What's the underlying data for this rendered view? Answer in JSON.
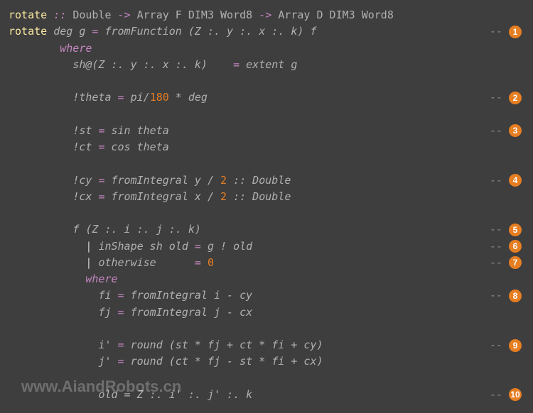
{
  "code": {
    "sig_fn": "rotate",
    "sig_dcolon": "::",
    "sig_t1": "Double",
    "sig_arr": "->",
    "sig_t2": "Array F DIM3 Word8",
    "sig_arr2": "->",
    "sig_t3": "Array D DIM3 Word8",
    "def_fn": "rotate",
    "def_args": "deg g",
    "def_eq": "=",
    "def_body": "fromFunction (Z :. y :. x :. k) f",
    "where": "where",
    "sh_lhs": "sh@(Z :. y :. x :. k)",
    "sh_eq": "=",
    "sh_rhs": "extent g",
    "theta_lhs": "!theta",
    "theta_eq": "=",
    "theta_rhs1": "pi/",
    "theta_180": "180",
    "theta_rhs2": " * deg",
    "st_lhs": "!st",
    "st_eq": "=",
    "st_rhs": "sin theta",
    "ct_lhs": "!ct",
    "ct_eq": "=",
    "ct_rhs": "cos theta",
    "cy_lhs": "!cy",
    "cy_eq": "=",
    "cy_rhs1": "fromIntegral y /",
    "cy_2": "2",
    "cy_rhs2": " :: Double",
    "cx_lhs": "!cx",
    "cx_eq": "=",
    "cx_rhs1": "fromIntegral x /",
    "cx_2": "2",
    "cx_rhs2": " :: Double",
    "f_head": "f (Z :. i :. j :. k)",
    "g1_bar": "|",
    "g1_cond": "inShape sh old",
    "g1_eq": "=",
    "g1_rhs": "g ! old",
    "g2_bar": "|",
    "g2_cond": "otherwise",
    "g2_eq": "=",
    "g2_rhs": "0",
    "where2": "where",
    "fi_lhs": "fi",
    "fi_eq": "=",
    "fi_rhs": "fromIntegral i - cy",
    "fj_lhs": "fj",
    "fj_eq": "=",
    "fj_rhs": "fromIntegral j - cx",
    "ip_lhs": "i'",
    "ip_eq": "=",
    "ip_rhs": "round (st * fj + ct * fi + cy)",
    "jp_lhs": "j'",
    "jp_eq": "=",
    "jp_rhs": "round (ct * fj - st * fi + cx)",
    "old_line": "old = Z :. i' :. j' :. k"
  },
  "annotations": {
    "dash": "--",
    "n1": "1",
    "n2": "2",
    "n3": "3",
    "n4": "4",
    "n5": "5",
    "n6": "6",
    "n7": "7",
    "n8": "8",
    "n9": "9",
    "n10": "10"
  },
  "watermark": "www.AiandRobots.cn"
}
